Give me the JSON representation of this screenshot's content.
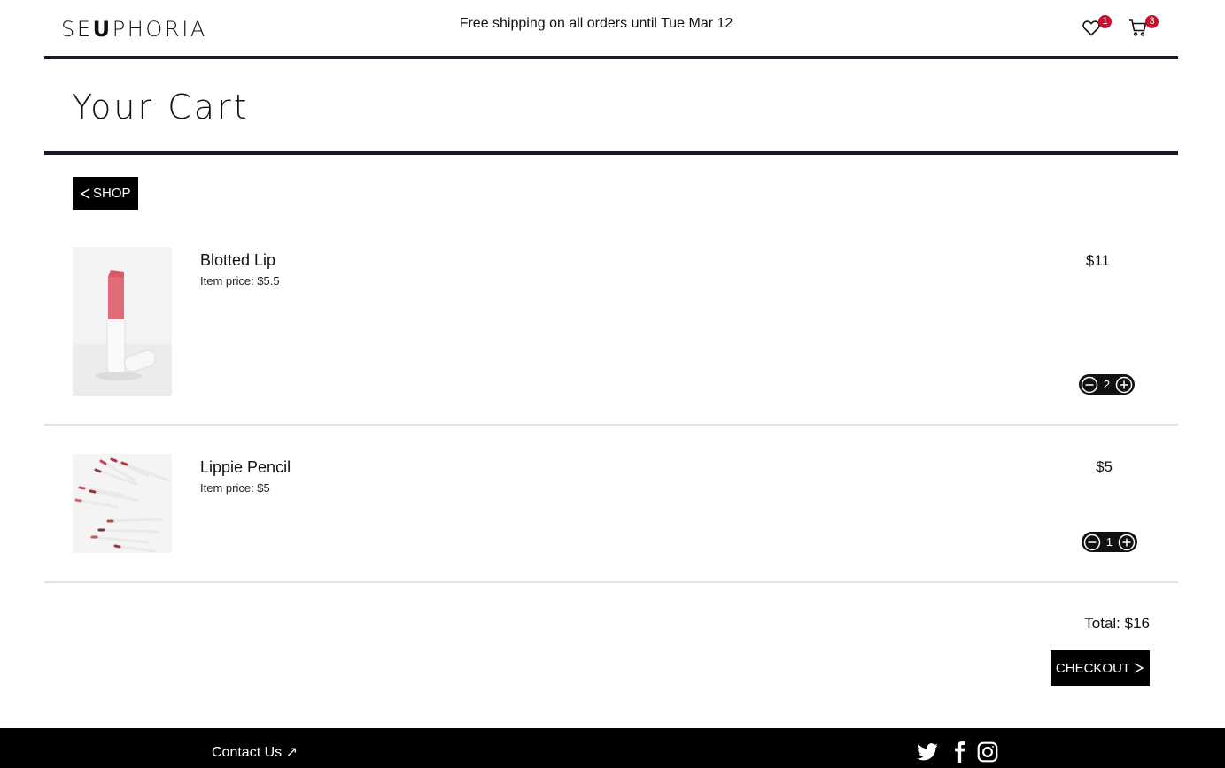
{
  "header": {
    "logo_parts": [
      "SE",
      "U",
      "PHORIA"
    ],
    "promo": "Free shipping on all orders until Tue Mar 12",
    "wishlist_count": "1",
    "cart_count": "3"
  },
  "page": {
    "title": "Your Cart",
    "shop_label": "SHOP"
  },
  "items": [
    {
      "name": "Blotted Lip",
      "price_label": "Item price: $5.5",
      "line_total": "$11",
      "quantity": "2"
    },
    {
      "name": "Lippie Pencil",
      "price_label": "Item price: $5",
      "line_total": "$5",
      "quantity": "1"
    }
  ],
  "summary": {
    "total": "Total: $16",
    "checkout_label": "CHECKOUT"
  },
  "footer": {
    "contact": "Contact Us ↗",
    "social": [
      "twitter-icon",
      "facebook-icon",
      "instagram-icon"
    ]
  },
  "colors": {
    "badge": "#c8102e",
    "rule": "#161a22",
    "button": "#000000"
  }
}
